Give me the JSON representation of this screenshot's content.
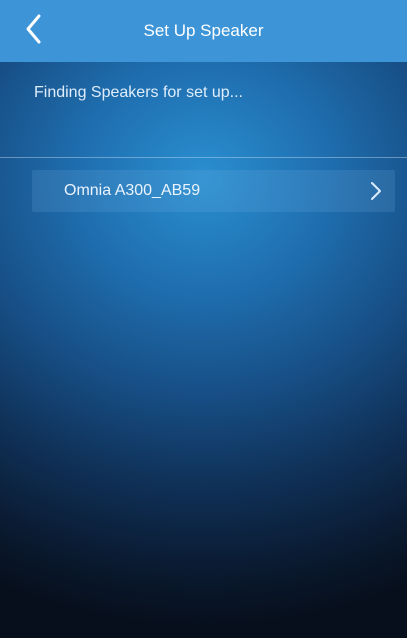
{
  "header": {
    "title": "Set Up Speaker",
    "back_icon": "chevron-left-icon"
  },
  "status_text": "Finding Speakers for set up...",
  "speakers": [
    {
      "name": "Omnia A300_AB59",
      "icon": "chevron-right-icon"
    }
  ],
  "colors": {
    "topbar": "#3d95d8",
    "accent": "#2a8fd0"
  }
}
